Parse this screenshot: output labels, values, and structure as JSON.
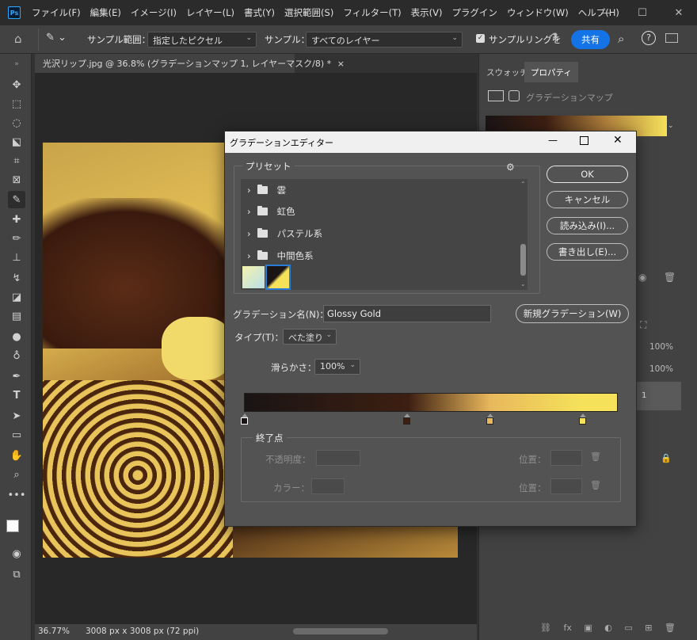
{
  "app": {
    "logo": "Ps"
  },
  "menu": [
    "ファイル(F)",
    "編集(E)",
    "イメージ(I)",
    "レイヤー(L)",
    "書式(Y)",
    "選択範囲(S)",
    "フィルター(T)",
    "表示(V)",
    "プラグイン",
    "ウィンドウ(W)",
    "ヘルプ(H)"
  ],
  "window_controls": {
    "minimize": "—",
    "maximize": "☐",
    "close": "✕"
  },
  "options": {
    "sample_size_label": "サンプル範囲：",
    "sample_size_value": "指定したピクセル",
    "sample_label": "サンプル：",
    "sample_value": "すべてのレイヤー",
    "sampling_ring_label": "サンプルリングを",
    "share_label": "共有"
  },
  "document": {
    "tab_title": "光沢リップ.jpg @ 36.8% (グラデーションマップ 1, レイヤーマスク/8) *",
    "zoom": "36.77%",
    "dimensions": "3008 px x 3008 px (72 ppi)"
  },
  "panel": {
    "tabs": [
      "スウォッチ",
      "プロパティ"
    ],
    "adjustment_title": "グラデーションマップ",
    "zoom_values": [
      "100%",
      "100%"
    ],
    "layer_suffix": "1"
  },
  "dialog": {
    "title": "グラデーションエディター",
    "buttons": {
      "ok": "OK",
      "cancel": "キャンセル",
      "load": "読み込み(I)...",
      "save": "書き出し(E)..."
    },
    "presets_label": "プリセット",
    "preset_folders": [
      "雲",
      "虹色",
      "パステル系",
      "中間色系"
    ],
    "name_label": "グラデーション名(N)：",
    "name_value": "Glossy Gold",
    "new_gradient_button": "新規グラデーション(W)",
    "type_label": "タイプ(T)：",
    "type_value": "べた塗り",
    "smoothness_label": "滑らかさ：",
    "smoothness_value": "100%",
    "stops_group_label": "終了点",
    "opacity_label": "不透明度：",
    "color_label": "カラー：",
    "location_label_1": "位置：",
    "location_label_2": "位置："
  },
  "colors": {
    "gradient_stops": [
      "#1a1414",
      "#3d1f12",
      "#e8b85c",
      "#f5e15a"
    ],
    "accent": "#1473e6"
  },
  "icons": [
    "home-icon",
    "eyedropper-icon",
    "search-icon",
    "help-icon",
    "gear-icon",
    "trash-icon"
  ]
}
